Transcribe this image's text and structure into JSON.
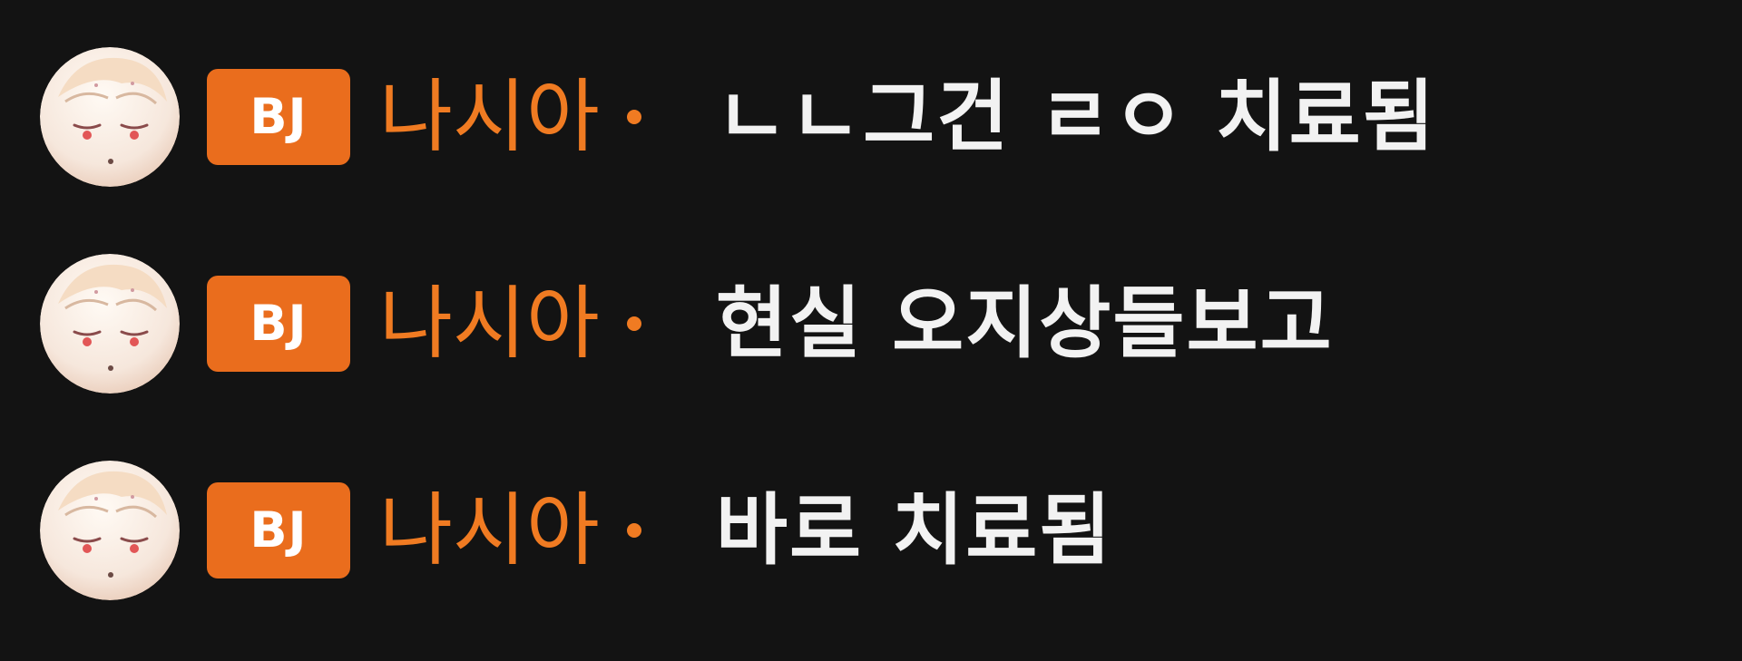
{
  "chat": {
    "messages": [
      {
        "badge": "BJ",
        "nickname": "나시아",
        "text": "ㄴㄴ그건 ㄹㅇ 치료됨"
      },
      {
        "badge": "BJ",
        "nickname": "나시아",
        "text": "현실 오지상들보고"
      },
      {
        "badge": "BJ",
        "nickname": "나시아",
        "text": "바로 치료됨"
      }
    ]
  },
  "colors": {
    "background": "#131313",
    "badge_bg": "#ea6d1d",
    "nickname": "#f07b22",
    "message_text": "#f2f2f2"
  },
  "icons": {
    "avatar": "user-avatar-icon",
    "separator": "dot-icon"
  }
}
